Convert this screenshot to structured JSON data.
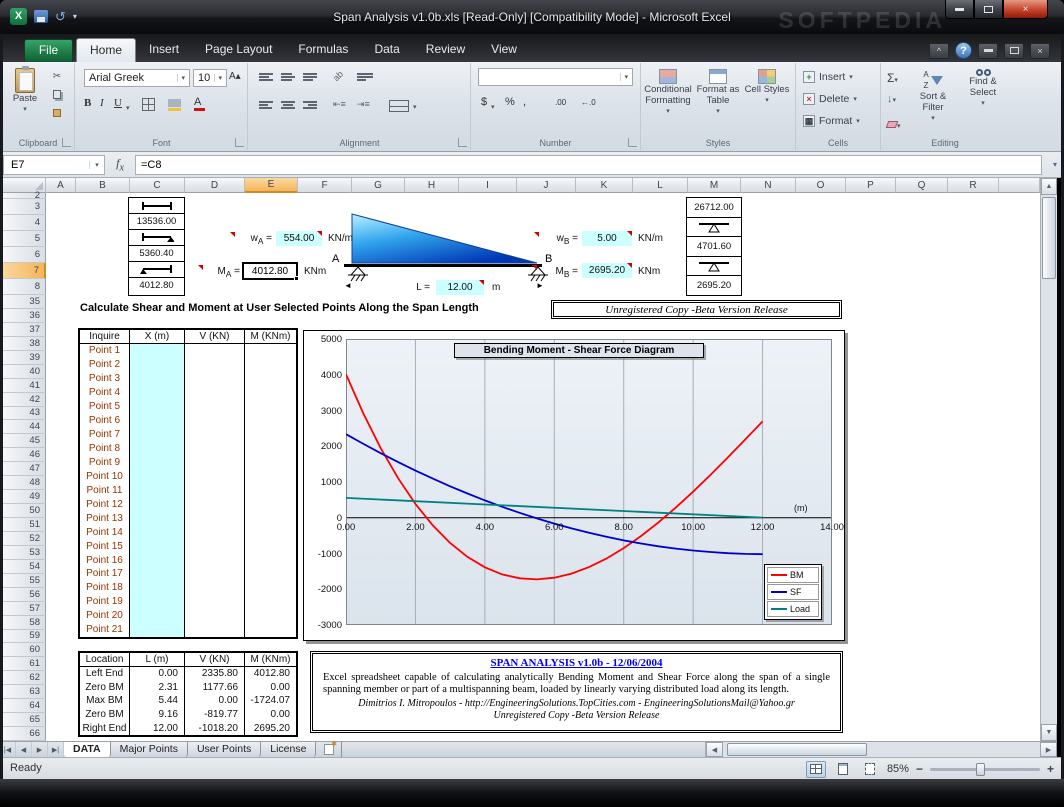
{
  "window": {
    "title": "Span Analysis v1.0b.xls  [Read-Only]  [Compatibility Mode]  -  Microsoft Excel",
    "watermark": "SOFTPEDIA"
  },
  "ribbon": {
    "file_tab": "File",
    "tabs": [
      "Home",
      "Insert",
      "Page Layout",
      "Formulas",
      "Data",
      "Review",
      "View"
    ],
    "active_tab": "Home",
    "clipboard": {
      "label": "Clipboard",
      "paste": "Paste"
    },
    "font": {
      "label": "Font",
      "name": "Arial Greek",
      "size": "10",
      "bold": "B",
      "italic": "I",
      "underline": "U"
    },
    "alignment": {
      "label": "Alignment"
    },
    "number": {
      "label": "Number",
      "currency": "$",
      "percent": "%",
      "comma": ",",
      "inc_decimal": ".00",
      "dec_decimal": "←.0"
    },
    "styles": {
      "label": "Styles",
      "conditional": "Conditional Formatting",
      "format_table": "Format as Table",
      "cell_styles": "Cell Styles"
    },
    "cells": {
      "label": "Cells",
      "insert": "Insert",
      "delete": "Delete",
      "format": "Format"
    },
    "editing": {
      "label": "Editing",
      "autosum": "Σ",
      "sort_filter": "Sort & Filter",
      "find_select": "Find & Select"
    }
  },
  "formula_bar": {
    "name_box": "E7",
    "formula": "=C8"
  },
  "grid": {
    "columns": [
      "A",
      "B",
      "C",
      "D",
      "E",
      "F",
      "G",
      "H",
      "I",
      "J",
      "K",
      "L",
      "M",
      "N",
      "O",
      "P",
      "Q",
      "R"
    ],
    "selected_column": "E",
    "rows": [
      2,
      3,
      4,
      5,
      6,
      7,
      8,
      35,
      36,
      37,
      38,
      39,
      40,
      41,
      42,
      43,
      44,
      45,
      46,
      47,
      48,
      49,
      50,
      51,
      52,
      53,
      54,
      55,
      56,
      57,
      58,
      59,
      60,
      61,
      62,
      63,
      64,
      65,
      66
    ],
    "selected_row": 7
  },
  "sheet": {
    "left_panel": {
      "values": [
        "13536.00",
        "5360.40",
        "4012.80"
      ]
    },
    "right_panel": {
      "values": [
        "26712.00",
        "4701.60",
        "2695.20"
      ]
    },
    "wA": {
      "sym": "w",
      "sub": "A",
      "eq": " =",
      "value": "554.00",
      "unit": "KN/m"
    },
    "MA": {
      "sym": "M",
      "sub": "A",
      "eq": " =",
      "value": "4012.80",
      "unit": "KNm"
    },
    "wB": {
      "sym": "w",
      "sub": "B",
      "eq": " =",
      "value": "5.00",
      "unit": "KN/m"
    },
    "MB": {
      "sym": "M",
      "sub": "B",
      "eq": " =",
      "value": "2695.20",
      "unit": "KNm"
    },
    "beam": {
      "a": "A",
      "b": "B",
      "L_label": "L =",
      "L_value": "12.00",
      "L_unit": "m"
    },
    "section_title": "Calculate Shear and Moment at User Selected Points Along the Span Length",
    "unregistered": "Unregistered Copy -Beta Version Release",
    "points_table": {
      "headers": [
        "Inquire",
        "X (m)",
        "V (KN)",
        "M (KNm)"
      ],
      "points": [
        "Point 1",
        "Point 2",
        "Point 3",
        "Point 4",
        "Point 5",
        "Point 6",
        "Point 7",
        "Point 8",
        "Point 9",
        "Point 10",
        "Point 11",
        "Point 12",
        "Point 13",
        "Point 14",
        "Point 15",
        "Point 16",
        "Point 17",
        "Point 18",
        "Point 19",
        "Point 20",
        "Point 21"
      ]
    },
    "results_table": {
      "headers": [
        "Location",
        "L (m)",
        "V (KN)",
        "M (KNm)"
      ],
      "rows": [
        [
          "Left End",
          "0.00",
          "2335.80",
          "4012.80"
        ],
        [
          "Zero BM",
          "2.31",
          "1177.66",
          "0.00"
        ],
        [
          "Max BM",
          "5.44",
          "0.00",
          "-1724.07"
        ],
        [
          "Zero BM",
          "9.16",
          "-819.77",
          "0.00"
        ],
        [
          "Right End",
          "12.00",
          "-1018.20",
          "2695.20"
        ]
      ]
    },
    "info_box": {
      "title": "SPAN ANALYSIS v1.0b  -  12/06/2004",
      "body": "Excel spreadsheet capable of calculating analytically Bending Moment and Shear Force along the span of a single spanning member or part of a multispanning beam, loaded by linearly varying distributed load along its length.",
      "author": "Dimitrios I. Mitropoulos - http://EngineeringSolutions.TopCities.com - EngineeringSolutionsMail@Yahoo.gr",
      "footer": "Unregistered  Copy -Beta Version Release"
    }
  },
  "chart_data": {
    "type": "line",
    "title": "Bending Moment - Shear Force Diagram",
    "xlabel": "(m)",
    "xlim": [
      0,
      14
    ],
    "ylim": [
      -3000,
      5000
    ],
    "grid": "vertical",
    "legend_position": "bottom-right",
    "x_ticks": [
      "0.00",
      "2.00",
      "4.00",
      "6.00",
      "8.00",
      "10.00",
      "12.00",
      "14.00"
    ],
    "y_ticks": [
      "5000",
      "4000",
      "3000",
      "2000",
      "1000",
      "0",
      "-1000",
      "-2000",
      "-3000"
    ],
    "series": [
      {
        "name": "BM",
        "color": "#FF0000",
        "x": [
          0,
          0.5,
          1,
          1.5,
          2,
          2.5,
          3,
          3.5,
          4,
          4.5,
          5,
          5.5,
          6,
          6.5,
          7,
          7.5,
          8,
          8.5,
          9,
          9.5,
          10,
          10.5,
          11,
          11.5,
          12
        ],
        "y": [
          4012.8,
          2913.2,
          1946.4,
          1106.6,
          388.2,
          -214.6,
          -707.5,
          -1096,
          -1386.4,
          -1583.8,
          -1694.3,
          -1723.5,
          -1677,
          -1560.9,
          -1380.2,
          -1141.3,
          -849.6,
          -511.4,
          -131,
          284.5,
          729.8,
          1199.3,
          1687.1,
          2187.7,
          2695.2
        ]
      },
      {
        "name": "SF",
        "color": "#0000CC",
        "x": [
          0,
          0.5,
          1,
          1.5,
          2,
          2.5,
          3,
          3.5,
          4,
          4.5,
          5,
          5.5,
          6,
          6.5,
          7,
          7.5,
          8,
          8.5,
          9,
          9.5,
          10,
          10.5,
          11,
          11.5,
          12
        ],
        "y": [
          2335.8,
          2064.5,
          1804.7,
          1556.3,
          1319.3,
          1093.8,
          879.7,
          677,
          485.8,
          306,
          137.7,
          -19.2,
          -164.7,
          -298.7,
          -421.3,
          -532.5,
          -632.2,
          -720.5,
          -797.3,
          -862.7,
          -916.7,
          -959.2,
          -990.3,
          -1010,
          -1018.2
        ]
      },
      {
        "name": "Load",
        "color": "#008080",
        "x": [
          0,
          12
        ],
        "y": [
          554,
          5
        ]
      }
    ]
  },
  "sheet_tabs": {
    "tabs": [
      "DATA",
      "Major Points",
      "User Points",
      "License"
    ],
    "active": "DATA"
  },
  "status_bar": {
    "mode": "Ready",
    "zoom": "85%"
  }
}
